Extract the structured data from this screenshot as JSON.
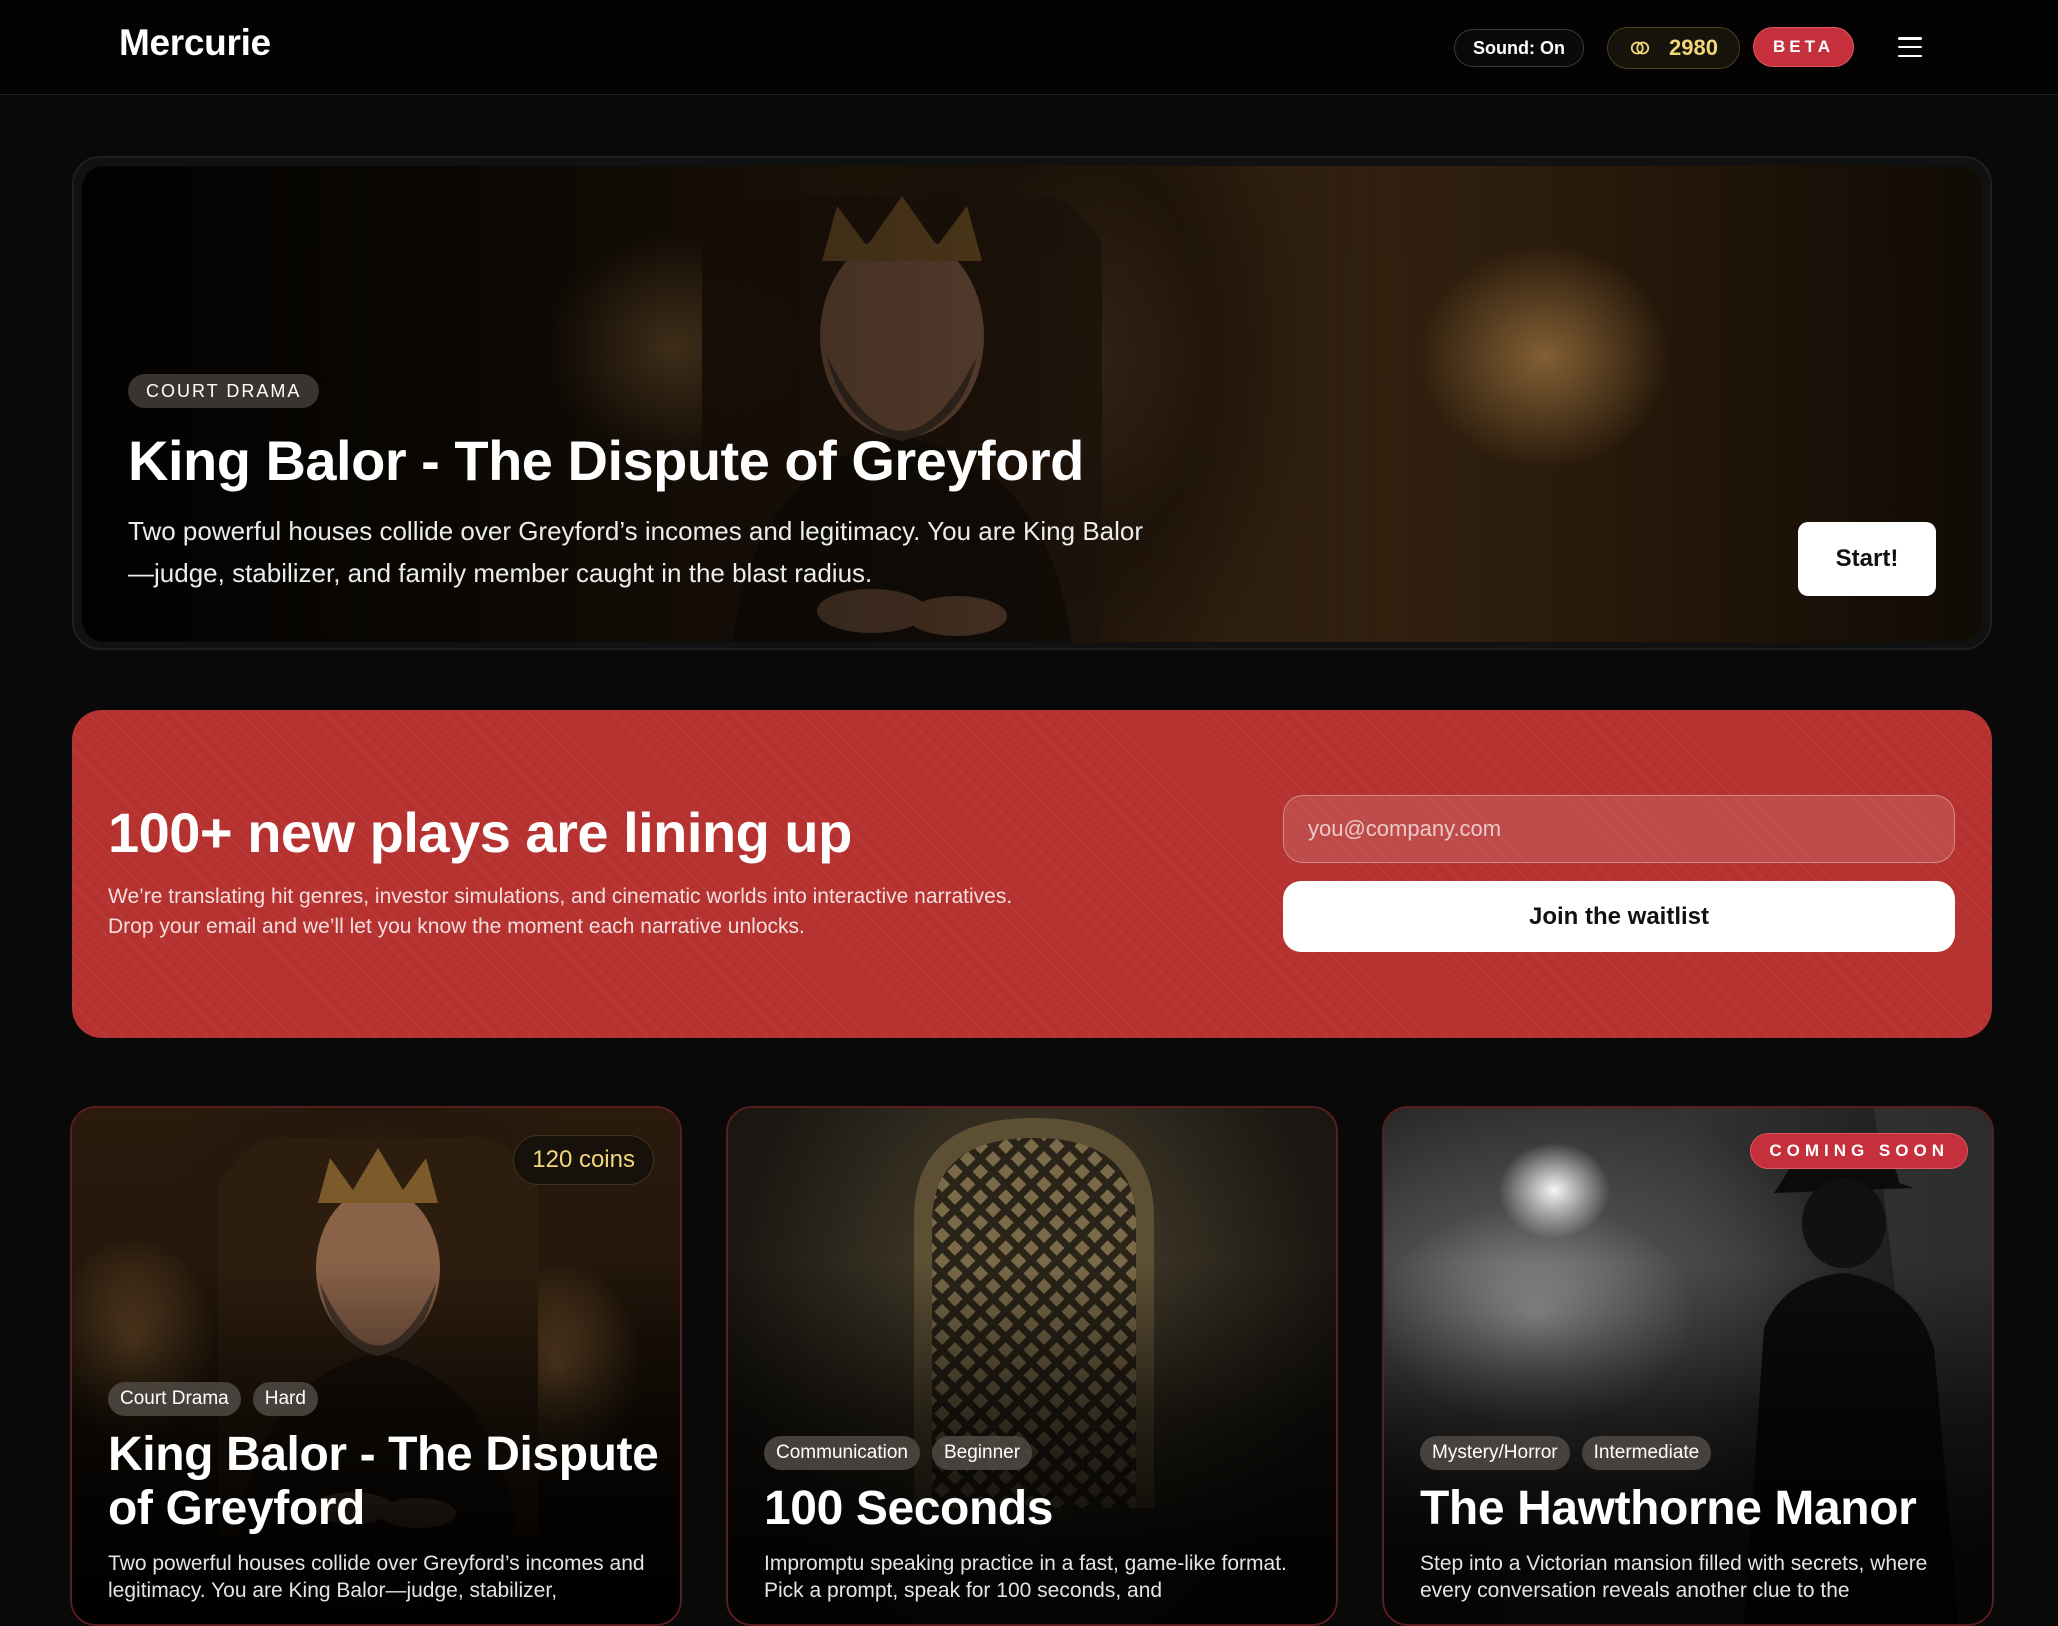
{
  "header": {
    "logo": "Mercurie",
    "sound_label": "Sound: On",
    "coins": "2980",
    "beta_label": "BETA"
  },
  "hero": {
    "tag": "COURT DRAMA",
    "title": "King Balor - The Dispute of Greyford",
    "description": "Two powerful houses collide over Greyford’s incomes and legitimacy. You are King Balor—judge, stabilizer, and family member caught in the blast radius.",
    "start_label": "Start!"
  },
  "waitlist": {
    "title": "100+ new plays are lining up",
    "description_line1": "We’re translating hit genres, investor simulations, and cinematic worlds into interactive narratives.",
    "description_line2": "Drop your email and we’ll let you know the moment each narrative unlocks.",
    "email_placeholder": "you@company.com",
    "button_label": "Join the waitlist"
  },
  "cards": [
    {
      "tags": [
        "Court Drama",
        "Hard"
      ],
      "title": "King Balor - The Dispute of Greyford",
      "description": "Two powerful houses collide over Greyford’s incomes and legitimacy. You are King Balor—judge, stabilizer,",
      "badge": "120 coins"
    },
    {
      "tags": [
        "Communication",
        "Beginner"
      ],
      "title": "100 Seconds",
      "description": "Impromptu speaking practice in a fast, game-like format. Pick a prompt, speak for 100 seconds, and"
    },
    {
      "tags": [
        "Mystery/Horror",
        "Intermediate"
      ],
      "title": "The Hawthorne Manor",
      "description": "Step into a Victorian mansion filled with secrets, where every conversation reveals another clue to the",
      "badge": "COMING SOON"
    }
  ],
  "colors": {
    "background": "#09090a",
    "accent_red": "#b53230",
    "beta_red": "#c5303c",
    "coin_gold": "#f3d57a"
  },
  "icons": {
    "coins": "coins-icon",
    "menu": "hamburger-menu-icon"
  }
}
